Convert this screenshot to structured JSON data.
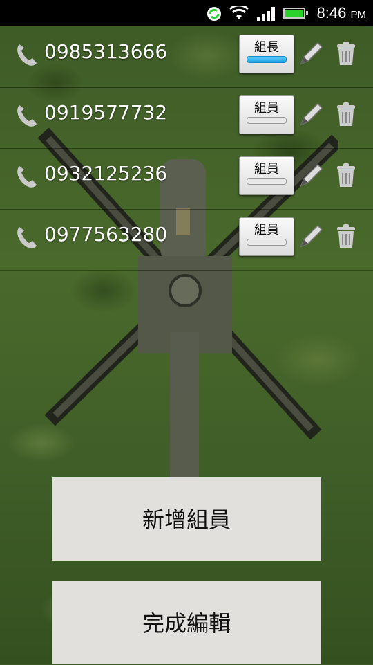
{
  "status_bar": {
    "time": "8:46",
    "ampm": "PM",
    "icons": [
      "sync-icon",
      "wifi-icon",
      "signal-icon",
      "battery-icon"
    ]
  },
  "members": [
    {
      "phone": "0985313666",
      "role": "組長",
      "active": true
    },
    {
      "phone": "0919577732",
      "role": "組員",
      "active": false
    },
    {
      "phone": "0932125236",
      "role": "組員",
      "active": false
    },
    {
      "phone": "0977563280",
      "role": "組員",
      "active": false
    }
  ],
  "actions": {
    "add_member": "新增組員",
    "finish_edit": "完成編輯"
  },
  "colors": {
    "active_indicator": "#1a9fe0",
    "button_bg": "#e2e0dc"
  }
}
